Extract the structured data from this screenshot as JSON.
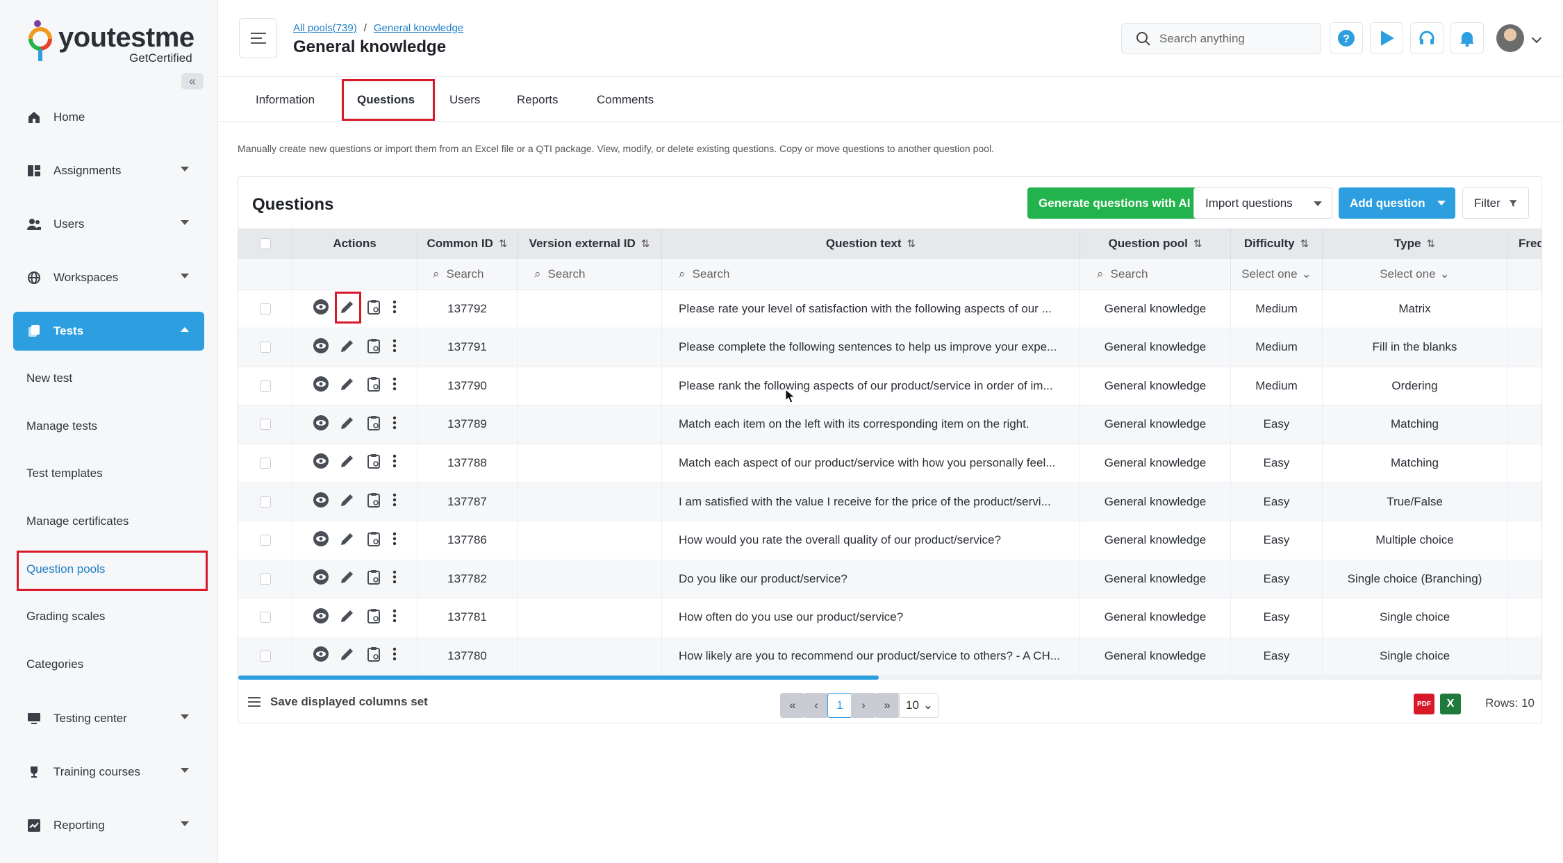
{
  "app": {
    "logo_text": "youtestme",
    "logo_sub": "GetCertified"
  },
  "sidebar": {
    "items": [
      {
        "label": "Home",
        "icon": "home-icon"
      },
      {
        "label": "Assignments",
        "icon": "assignments-icon"
      },
      {
        "label": "Users",
        "icon": "users-icon"
      },
      {
        "label": "Workspaces",
        "icon": "globe-icon"
      },
      {
        "label": "Tests",
        "icon": "tests-icon",
        "active": true
      },
      {
        "label": "Testing center",
        "icon": "monitor-icon"
      },
      {
        "label": "Training courses",
        "icon": "trophy-icon"
      },
      {
        "label": "Reporting",
        "icon": "reporting-icon"
      }
    ],
    "sub_items": [
      "New test",
      "Manage tests",
      "Test templates",
      "Manage certificates",
      "Question pools",
      "Grading scales",
      "Categories"
    ]
  },
  "header": {
    "breadcrumb": [
      "All pools(739)",
      "General knowledge"
    ],
    "breadcrumb_sep": "/",
    "title": "General knowledge",
    "search_placeholder": "Search anything"
  },
  "tabs": [
    "Information",
    "Questions",
    "Users",
    "Reports",
    "Comments"
  ],
  "active_tab": "Questions",
  "description": "Manually create new questions or import them from an Excel file or a QTI package. View, modify, or delete existing questions. Copy or move questions to another question pool.",
  "card": {
    "title": "Questions",
    "btn_generate": "Generate questions with AI",
    "btn_import": "Import questions",
    "btn_add": "Add question",
    "btn_filter": "Filter"
  },
  "table": {
    "headers": {
      "actions": "Actions",
      "common_id": "Common ID",
      "version_id": "Version external ID",
      "question_text": "Question text",
      "question_pool": "Question pool",
      "difficulty": "Difficulty",
      "type": "Type",
      "freq": "Frequ"
    },
    "filters": {
      "search": "Search",
      "select": "Select one"
    },
    "rows": [
      {
        "id": "137792",
        "text": "Please rate your level of satisfaction with the following aspects of our ...",
        "pool": "General knowledge",
        "difficulty": "Medium",
        "type": "Matrix"
      },
      {
        "id": "137791",
        "text": "Please complete the following sentences to help us improve your expe...",
        "pool": "General knowledge",
        "difficulty": "Medium",
        "type": "Fill in the blanks"
      },
      {
        "id": "137790",
        "text": "Please rank the following aspects of our product/service in order of im...",
        "pool": "General knowledge",
        "difficulty": "Medium",
        "type": "Ordering"
      },
      {
        "id": "137789",
        "text": "Match each item on the left with its corresponding item on the right.",
        "pool": "General knowledge",
        "difficulty": "Easy",
        "type": "Matching"
      },
      {
        "id": "137788",
        "text": "Match each aspect of our product/service with how you personally feel...",
        "pool": "General knowledge",
        "difficulty": "Easy",
        "type": "Matching"
      },
      {
        "id": "137787",
        "text": "I am satisfied with the value I receive for the price of the product/servi...",
        "pool": "General knowledge",
        "difficulty": "Easy",
        "type": "True/False"
      },
      {
        "id": "137786",
        "text": "How would you rate the overall quality of our product/service?",
        "pool": "General knowledge",
        "difficulty": "Easy",
        "type": "Multiple choice"
      },
      {
        "id": "137782",
        "text": "Do you like our product/service?",
        "pool": "General knowledge",
        "difficulty": "Easy",
        "type": "Single choice (Branching)"
      },
      {
        "id": "137781",
        "text": "How often do you use our product/service?",
        "pool": "General knowledge",
        "difficulty": "Easy",
        "type": "Single choice"
      },
      {
        "id": "137780",
        "text": "How likely are you to recommend our product/service to others? - A CH...",
        "pool": "General knowledge",
        "difficulty": "Easy",
        "type": "Single choice"
      }
    ]
  },
  "footer": {
    "save_columns": "Save displayed columns set",
    "current_page": "1",
    "page_size": "10",
    "rows_label": "Rows: 10",
    "export_pdf": "PDF",
    "export_excel": "X"
  },
  "colors": {
    "accent": "#2d9fe0",
    "green": "#22b34c",
    "highlight": "#d7192a"
  }
}
